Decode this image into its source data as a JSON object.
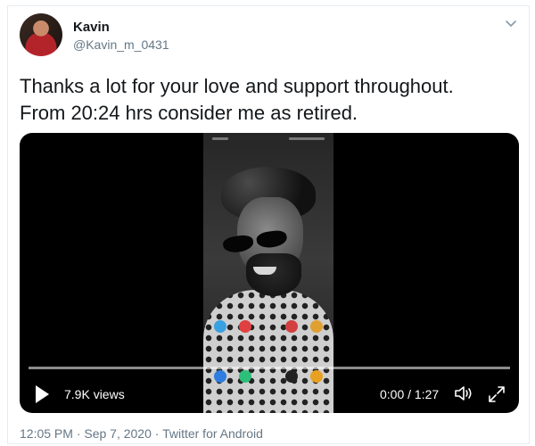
{
  "tweet": {
    "author_name": "Kavin",
    "author_handle": "@Kavin_m_0431",
    "text_line1": "Thanks a lot for your love and support throughout.",
    "text_line2": "From 20:24 hrs consider me as retired.",
    "timestamp": "12:05 PM · Sep 7, 2020 · Twitter for Android"
  },
  "video": {
    "views": "7.9K views",
    "time": "0:00 / 1:27",
    "progress": 0.0
  },
  "icons": {
    "avatar": "avatar",
    "caret": "chevron-down-icon",
    "play": "play-icon",
    "volume": "volume-icon",
    "fullscreen": "fullscreen-icon"
  },
  "colors": {
    "text_primary": "#14171a",
    "text_secondary": "#657786",
    "border": "#e6ecf0",
    "video_bg": "#000000"
  }
}
